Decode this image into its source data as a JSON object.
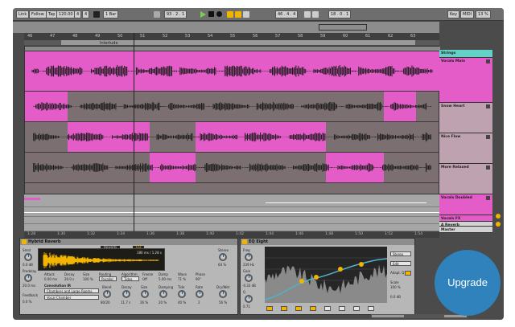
{
  "control_bar": {
    "link": "Link",
    "follow": "Follow",
    "tap": "Tap",
    "tempo": "120.00",
    "sig_num": "4",
    "sig_den": "4",
    "quant": "1 Bar",
    "position": "93 . 2 . 1",
    "loop_start": "46 . 4 . 4",
    "loop_len": "18 . 0 . 1",
    "key": "Key",
    "midi": "MIDI",
    "cpu": "13 %"
  },
  "ruler_marks": [
    "46",
    "47",
    "48",
    "49",
    "50",
    "51",
    "52",
    "53",
    "54",
    "55",
    "56",
    "57",
    "58",
    "59",
    "60",
    "61",
    "62",
    "63"
  ],
  "locator_label": "Interlude",
  "tracks": [
    {
      "name": "Strings",
      "color": "#62d2c8"
    },
    {
      "name": "Vocals Main",
      "color": "#e35cc8"
    },
    {
      "name": "Snow Heart",
      "color": "#bfa2b0"
    },
    {
      "name": "Nice Flow",
      "color": "#bfa2b0"
    },
    {
      "name": "More Relaxed",
      "color": "#bfa2b0"
    },
    {
      "name": "Vocals Doubled",
      "color": "#e35cc8"
    },
    {
      "name": "Vocals FX",
      "color": "#e35cc8"
    },
    {
      "name": "A Reverb",
      "color": "#d2d2d2"
    },
    {
      "name": "Master",
      "color": "#d2d2d2"
    }
  ],
  "bottom_ruler": [
    "1:28",
    "1:30",
    "1:32",
    "1:34",
    "1:36",
    "1:38",
    "1:40",
    "1:42",
    "1:44",
    "1:46",
    "1:48",
    "1:50",
    "1:52",
    "1:54"
  ],
  "reverb": {
    "title": "Hybrid Reverb",
    "tab_reverb": "Reverb",
    "tab_eq": "EQ",
    "ir_info": "180 ms / 1.28 s",
    "labels": [
      "Send",
      "Predelay",
      "Feedback",
      "Attack",
      "Decay",
      "Size",
      "Routing",
      "Algorithm",
      "Freeze",
      "Damp",
      "Wave",
      "Phase",
      "Dry/Wet"
    ],
    "send": "0.0 dB",
    "predelay": "20.0 ms",
    "feedback": "0.0 %",
    "attack": "0.00 ms",
    "decay": "20.0 s",
    "size": "100 %",
    "routing": "Parallel",
    "algorithm": "Tides",
    "freeze_val": "Off",
    "damp": "5.00 ms",
    "wave": "71 %",
    "phase": "90°",
    "convolution_title": "Convolution IR",
    "ir_category": "Chambers and Large Rooms",
    "ir_name": "Vocal Chamber",
    "blend_label": "Blend",
    "blend": "80/20",
    "decay2_label": "Decay",
    "decay2": "11.7 s",
    "size2_label": "Size",
    "size2": "26 %",
    "damping_label": "Damping",
    "damping": "20 %",
    "tide_label": "Tide",
    "tide": "40 %",
    "rate_label": "Rate",
    "rate": "2",
    "drywet_label": "Dry/Wet",
    "drywet": "56 %",
    "stereo_label": "Stereo",
    "stereo": "64 %"
  },
  "eq": {
    "title": "EQ Eight",
    "freq_label": "Freq",
    "freq": "239 Hz",
    "gain_label": "Gain",
    "gain": "-0.33 dB",
    "q_label": "Q",
    "q": "0.71",
    "mode": "Stereo",
    "edit": "Edit",
    "adapt_q": "Adapt. Q",
    "scale_label": "Scale",
    "scale": "100 %",
    "out_gain": "0.0 dB"
  },
  "upgrade_label": "Upgrade",
  "colors": {
    "accent": "#f1b400",
    "clip_pink": "#e35cc8",
    "upgrade_blue": "#2f82bb",
    "play_green": "#7ad04a"
  }
}
